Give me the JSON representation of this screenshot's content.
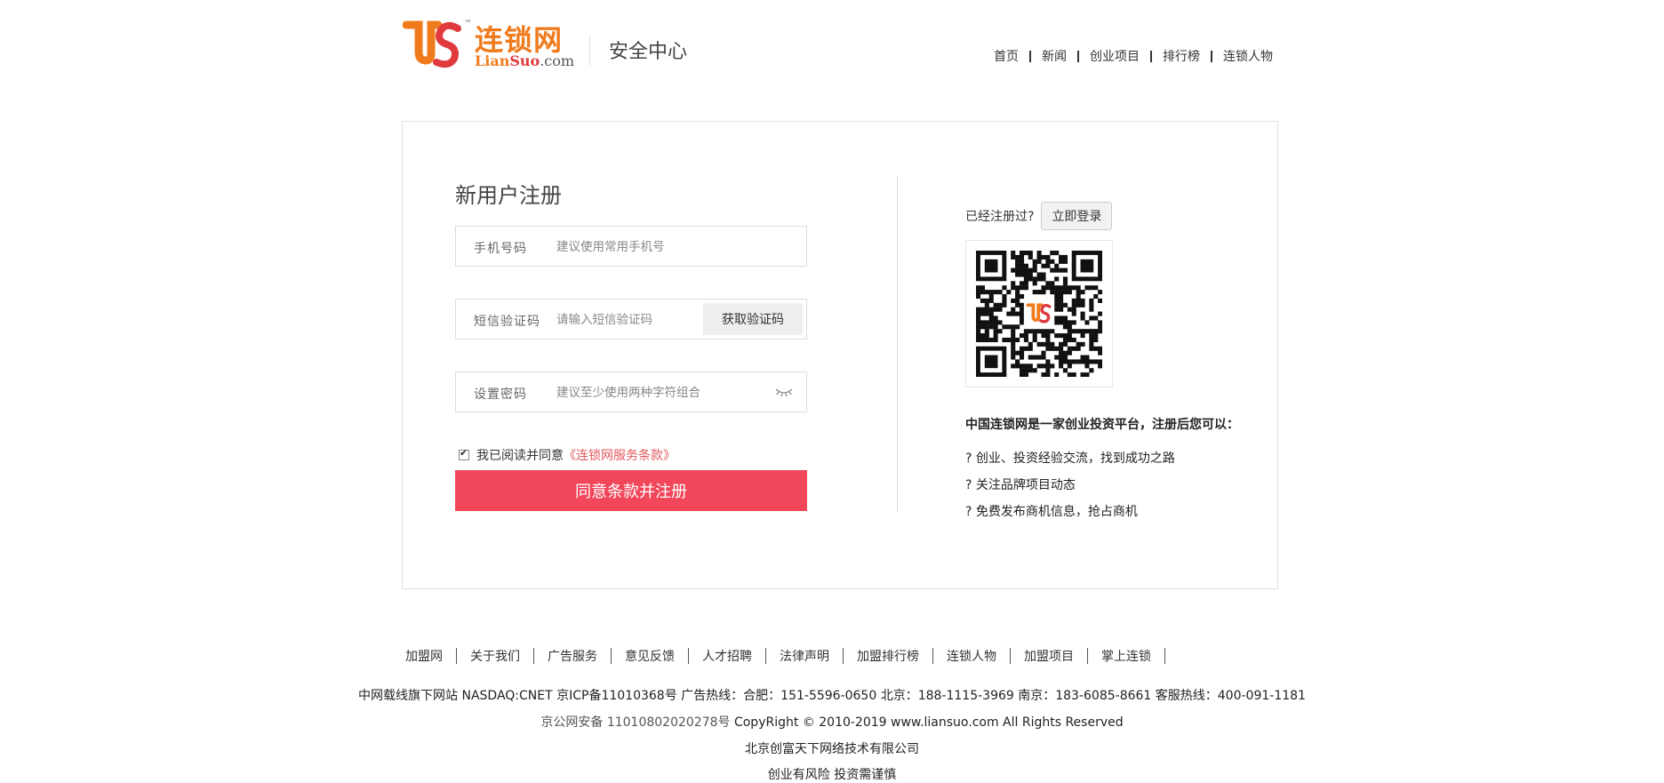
{
  "header": {
    "logo_cn": "连锁网",
    "logo_en_1": "Lian",
    "logo_en_2": "Suo",
    "logo_en_3": ".com",
    "logo_tm": "™",
    "subtitle": "安全中心",
    "nav": [
      "首页",
      "新闻",
      "创业项目",
      "排行榜",
      "连锁人物"
    ]
  },
  "register": {
    "title": "新用户注册",
    "phone_label": "手机号码",
    "phone_placeholder": "建议使用常用手机号",
    "sms_label": "短信验证码",
    "sms_placeholder": "请输入短信验证码",
    "sms_button": "获取验证码",
    "password_label": "设置密码",
    "password_placeholder": "建议至少使用两种字符组合",
    "agree_text": "我已阅读并同意",
    "agree_link": "《连锁网服务条款》",
    "agree_checked": true,
    "submit": "同意条款并注册"
  },
  "side": {
    "registered_text": "已经注册过?",
    "login_button": "立即登录",
    "intro_title": "中国连锁网是一家创业投资平台，注册后您可以：",
    "intro_items": [
      "? 创业、投资经验交流，找到成功之路",
      "? 关注品牌项目动态",
      "? 免费发布商机信息，抢占商机"
    ]
  },
  "footer": {
    "links": [
      "加盟网",
      "关于我们",
      "广告服务",
      "意见反馈",
      "人才招聘",
      "法律声明",
      "加盟排行榜",
      "连锁人物",
      "加盟项目",
      "掌上连锁"
    ],
    "line1": "中网载线旗下网站 NASDAQ:CNET 京ICP备11010368号 广告热线：合肥：151-5596-0650 北京：188-1115-3969 南京：183-6085-8661 客服热线：400-091-1181",
    "line2_prefix": "京公网安备",
    "line2_number": "11010802020278号",
    "line2_copyright": "CopyRight  © 2010-2019 www.liansuo.com All Rights Reserved",
    "line3": "北京创富天下网络技术有限公司",
    "line4": "创业有风险 投资需谨慎"
  },
  "colors": {
    "brand_orange": "#f07b1d",
    "brand_red": "#e03a3e",
    "submit_bg": "#f2475b",
    "link_red": "#e2575c"
  }
}
